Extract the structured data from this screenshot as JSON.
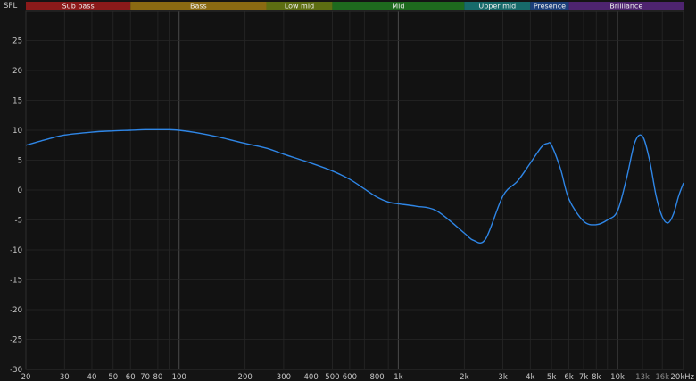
{
  "chart_data": {
    "type": "line",
    "ylabel": "SPL",
    "xscale": "log",
    "xlim": [
      20,
      20000
    ],
    "ylim": [
      -30,
      30
    ],
    "grid": true,
    "yticks": [
      -30,
      -25,
      -20,
      -15,
      -10,
      -5,
      0,
      5,
      10,
      15,
      20,
      25
    ],
    "xticks": [
      {
        "value": 20,
        "label": "20"
      },
      {
        "value": 30,
        "label": "30"
      },
      {
        "value": 40,
        "label": "40"
      },
      {
        "value": 50,
        "label": "50"
      },
      {
        "value": 60,
        "label": "60"
      },
      {
        "value": 70,
        "label": "70"
      },
      {
        "value": 80,
        "label": "80"
      },
      {
        "value": 90,
        "label": ""
      },
      {
        "value": 100,
        "label": "100"
      },
      {
        "value": 200,
        "label": "200"
      },
      {
        "value": 300,
        "label": "300"
      },
      {
        "value": 400,
        "label": "400"
      },
      {
        "value": 500,
        "label": "500"
      },
      {
        "value": 600,
        "label": "600"
      },
      {
        "value": 700,
        "label": ""
      },
      {
        "value": 800,
        "label": "800"
      },
      {
        "value": 900,
        "label": ""
      },
      {
        "value": 1000,
        "label": "1k"
      },
      {
        "value": 2000,
        "label": "2k"
      },
      {
        "value": 3000,
        "label": "3k"
      },
      {
        "value": 4000,
        "label": "4k"
      },
      {
        "value": 5000,
        "label": "5k"
      },
      {
        "value": 6000,
        "label": "6k"
      },
      {
        "value": 7000,
        "label": "7k"
      },
      {
        "value": 8000,
        "label": "8k"
      },
      {
        "value": 9000,
        "label": ""
      },
      {
        "value": 10000,
        "label": "10k"
      },
      {
        "value": 13000,
        "label": "13k",
        "dim": true
      },
      {
        "value": 16000,
        "label": "16k",
        "dim": true
      },
      {
        "value": 20000,
        "label": "20kHz"
      }
    ],
    "bands": [
      {
        "name": "Sub bass",
        "from": 20,
        "to": 60,
        "color": "#8b1a1a"
      },
      {
        "name": "Bass",
        "from": 60,
        "to": 250,
        "color": "#8a6a12"
      },
      {
        "name": "Low mid",
        "from": 250,
        "to": 500,
        "color": "#5d6e12"
      },
      {
        "name": "Mid",
        "from": 500,
        "to": 2000,
        "color": "#1e6a1e"
      },
      {
        "name": "Upper mid",
        "from": 2000,
        "to": 4000,
        "color": "#176a6a"
      },
      {
        "name": "Presence",
        "from": 4000,
        "to": 6000,
        "color": "#1c3f7a"
      },
      {
        "name": "Brilliance",
        "from": 6000,
        "to": 20000,
        "color": "#4e2470"
      }
    ],
    "series": [
      {
        "color": "#2f86e6",
        "x": [
          20,
          25,
          30,
          40,
          50,
          60,
          70,
          80,
          90,
          100,
          120,
          150,
          200,
          250,
          300,
          400,
          500,
          600,
          700,
          800,
          900,
          1000,
          1200,
          1500,
          2000,
          2200,
          2500,
          3000,
          3500,
          4000,
          4500,
          4800,
          5000,
          5500,
          6000,
          7000,
          8000,
          9000,
          10000,
          11000,
          12000,
          13000,
          14000,
          15000,
          16000,
          17000,
          18000,
          19000,
          20000
        ],
        "y": [
          7.5,
          8.5,
          9.2,
          9.7,
          9.9,
          10.0,
          10.1,
          10.1,
          10.1,
          10.0,
          9.6,
          8.9,
          7.8,
          7.0,
          6.0,
          4.5,
          3.2,
          1.8,
          0.2,
          -1.2,
          -2.0,
          -2.3,
          -2.7,
          -3.5,
          -7.2,
          -8.4,
          -8.2,
          -1.0,
          1.5,
          4.5,
          7.2,
          7.8,
          7.5,
          3.5,
          -1.5,
          -5.2,
          -5.8,
          -5.0,
          -3.5,
          2.0,
          8.0,
          9.0,
          5.0,
          -1.0,
          -4.5,
          -5.5,
          -4.0,
          -1.0,
          1.2
        ]
      }
    ]
  }
}
